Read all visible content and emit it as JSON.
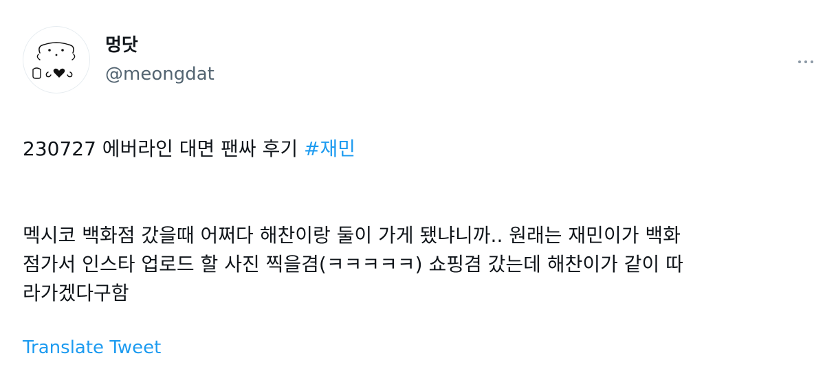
{
  "author": {
    "display_name": "멍닷",
    "handle": "@meongdat"
  },
  "icons": {
    "avatar": "cartoon-bear-avatar-icon",
    "more": "more-horizontal-icon"
  },
  "tweet": {
    "line1_text": "230727 에버라인 대면 팬싸 후기 ",
    "hashtag": "#재민",
    "para2": [
      "멕시코 백화점 갔을때 어쩌다 해찬이랑 둘이 가게 됐냐니까.. 원래는 재민이가 백화",
      "점가서 인스타 업로드 할 사진 찍을겸(ㅋㅋㅋㅋㅋ) 쇼핑겸 갔는데 해찬이가 같이 따",
      "라가겠다구함"
    ]
  },
  "actions": {
    "translate_label": "Translate Tweet"
  },
  "colors": {
    "link": "#1d9bf0",
    "secondary_text": "#536471",
    "primary_text": "#0f1419"
  }
}
